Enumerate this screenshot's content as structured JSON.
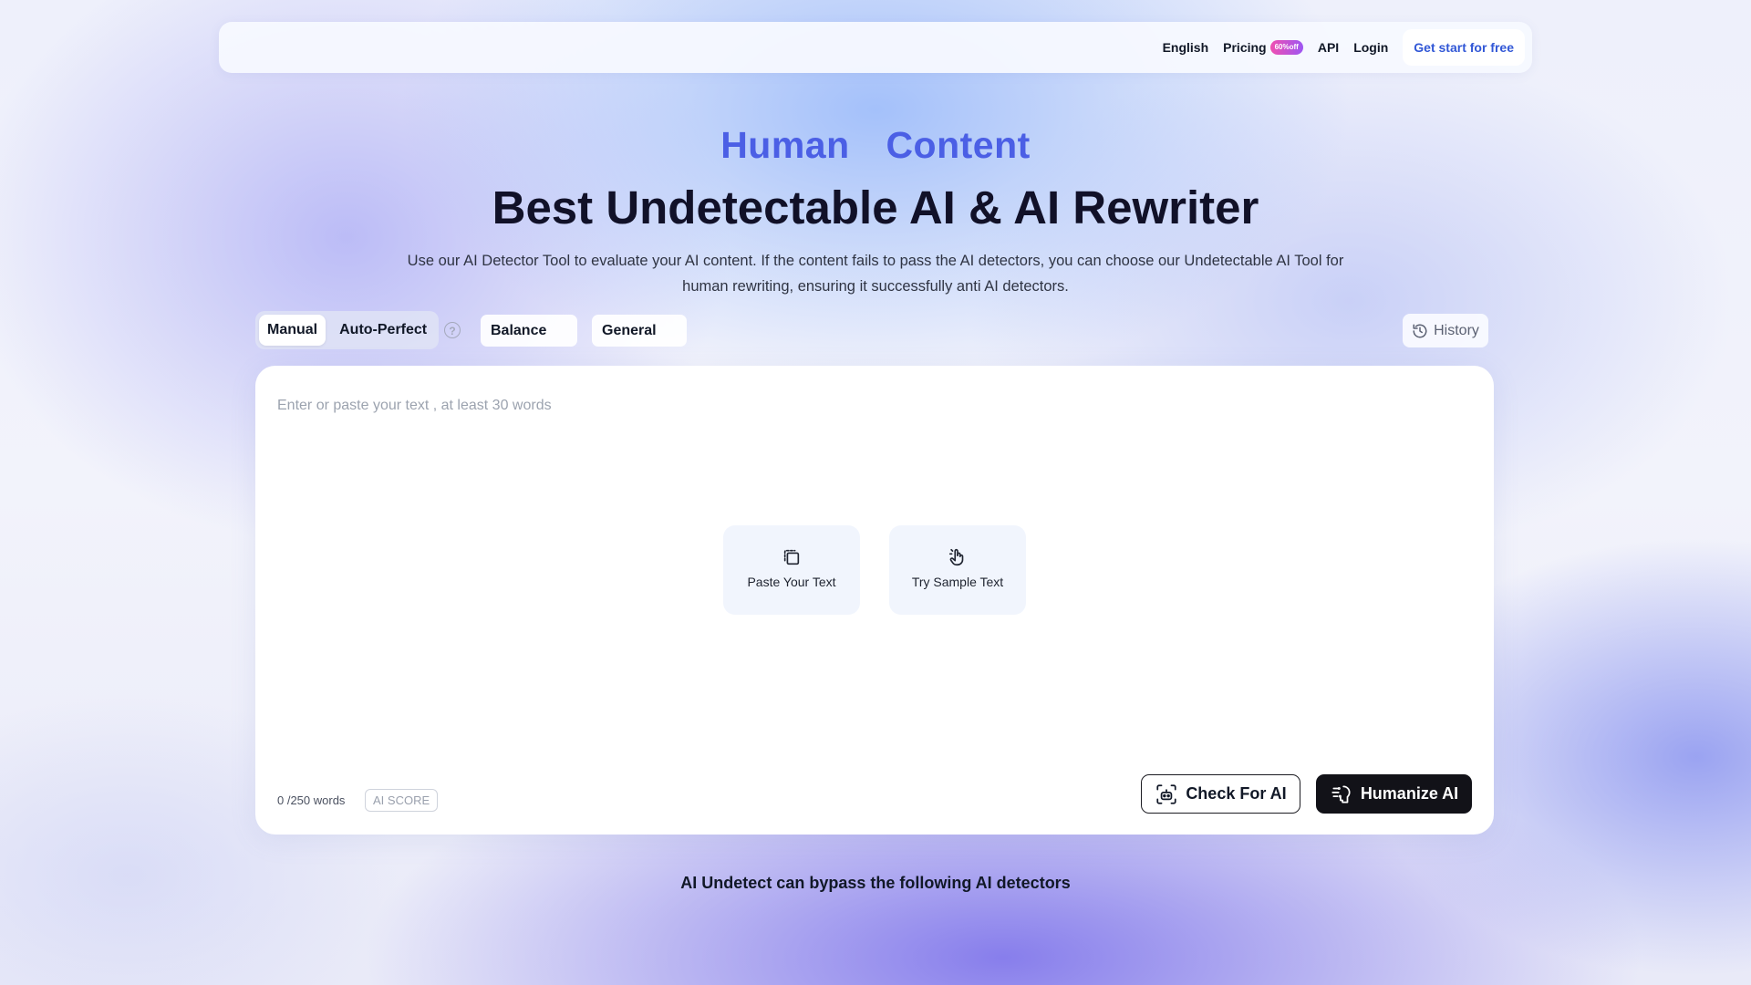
{
  "nav": {
    "language": "English",
    "pricing": "Pricing",
    "pricing_badge": "60%off",
    "api": "API",
    "login": "Login",
    "cta": "Get start for free"
  },
  "hero": {
    "eyebrow": "Human  Content",
    "title": "Best Undetectable AI & AI Rewriter",
    "description": "Use our AI Detector Tool to evaluate your AI content. If the content fails to pass the AI detectors, you can choose our Undetectable AI Tool for human rewriting, ensuring it successfully anti AI detectors."
  },
  "toolbar": {
    "mode_manual": "Manual",
    "mode_auto": "Auto-Perfect",
    "help": "?",
    "strength": "Balance",
    "purpose": "General",
    "history": "History"
  },
  "editor": {
    "placeholder": "Enter or paste your text , at least 30 words",
    "paste_label": "Paste Your Text",
    "sample_label": "Try Sample Text",
    "word_count": "0 /250 words",
    "ai_score": "AI SCORE",
    "check_label": "Check For AI",
    "humanize_label": "Humanize AI"
  },
  "footer": {
    "bypass_text": "AI Undetect can bypass the following AI detectors"
  },
  "colors": {
    "accent_blue": "#4b5fe5",
    "cta_text": "#3157d6",
    "primary_dark": "#121218",
    "badge_gradient_start": "#f04fb1",
    "badge_gradient_end": "#9d56f3"
  },
  "icons": {
    "help": "question-circle-icon",
    "history": "history-clock-icon",
    "paste": "clipboard-paste-icon",
    "sample": "pointer-hand-icon",
    "check": "scan-robot-icon",
    "humanize": "humanize-sparkle-icon"
  }
}
